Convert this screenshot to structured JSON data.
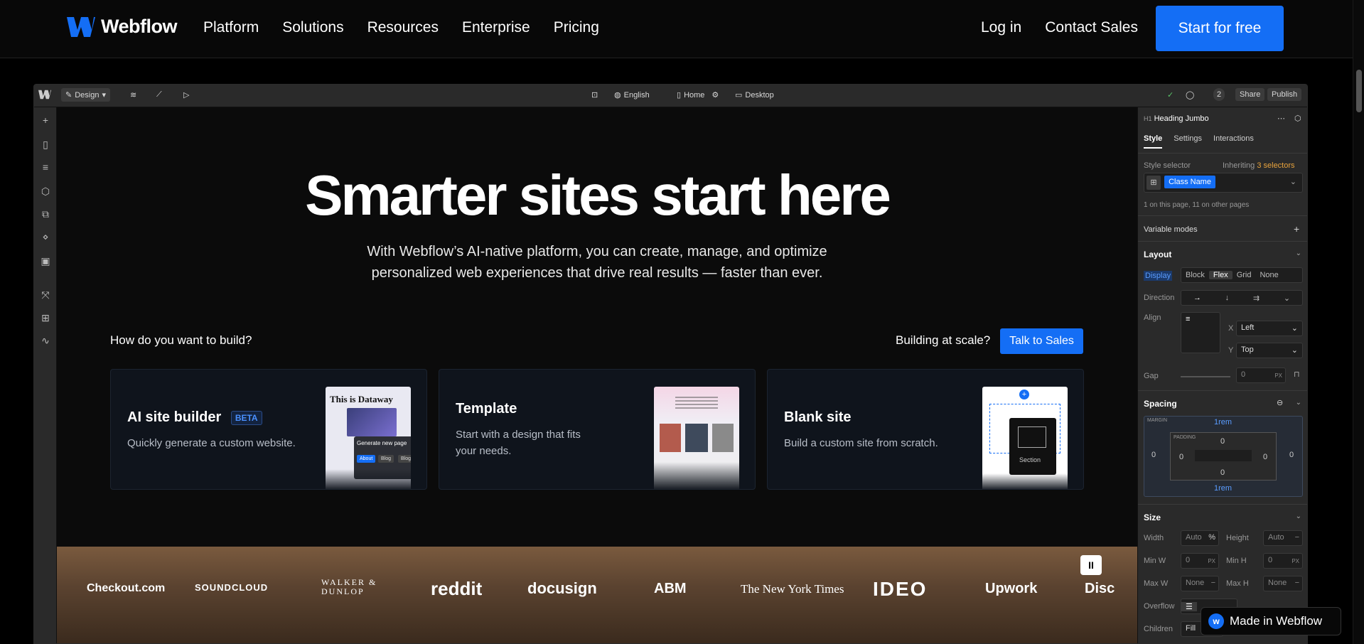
{
  "nav": {
    "brand": "Webflow",
    "links": [
      "Platform",
      "Solutions",
      "Resources",
      "Enterprise",
      "Pricing"
    ],
    "login": "Log in",
    "contact": "Contact Sales",
    "cta": "Start for free"
  },
  "designer": {
    "mode": "Design",
    "language": "English",
    "page": "Home",
    "breakpoint": "Desktop",
    "count": "2",
    "share": "Share",
    "publish": "Publish"
  },
  "hero": {
    "title": "Smarter sites start here",
    "subtitle": "With Webflow’s AI-native platform, you can create, manage, and optimize personalized web experiences that drive real results — faster than ever.",
    "question": "How do you want to build?",
    "scale": "Building at scale?",
    "talk": "Talk to Sales"
  },
  "cards": [
    {
      "title": "AI site builder",
      "badge": "BETA",
      "desc": "Quickly generate a custom website."
    },
    {
      "title": "Template",
      "desc": "Start with a design that fits your needs."
    },
    {
      "title": "Blank site",
      "desc": "Build a custom site from scratch."
    }
  ],
  "thumbs": {
    "dataway": "This is Dataway",
    "generate": "Generate new page",
    "about": "About",
    "blog": "Blog",
    "blogpost": "Blog Post",
    "section": "Section"
  },
  "logos": [
    "Checkout.com",
    "SOUNDCLOUD",
    "WALKER & DUNLOP",
    "reddit",
    "docusign",
    "ABM",
    "The New York Times",
    "IDEO",
    "Upwork",
    "Disc"
  ],
  "panel": {
    "element": "Heading Jumbo",
    "tag": "H1",
    "tabs": [
      "Style",
      "Settings",
      "Interactions"
    ],
    "style_selector": "Style selector",
    "inheriting": "Inheriting",
    "selectors": "3 selectors",
    "class_name": "Class Name",
    "usage": "1 on this page, 11 on other pages",
    "variable_modes": "Variable modes",
    "layout": "Layout",
    "display": "Display",
    "display_opts": [
      "Block",
      "Flex",
      "Grid",
      "None"
    ],
    "direction": "Direction",
    "align": "Align",
    "x": "X",
    "x_val": "Left",
    "y": "Y",
    "y_val": "Top",
    "gap": "Gap",
    "gap_val": "0",
    "px": "PX",
    "spacing": "Spacing",
    "margin": "MARGIN",
    "padding": "PADDING",
    "rem": "1rem",
    "zero": "0",
    "size": "Size",
    "width": "Width",
    "height": "Height",
    "auto": "Auto",
    "min_w": "Min W",
    "min_h": "Min H",
    "max_w": "Max W",
    "max_h": "Max H",
    "none": "None",
    "pct": "%",
    "overflow": "Overflow",
    "children": "Children",
    "fill": "Fill"
  },
  "badge": "Made in Webflow"
}
